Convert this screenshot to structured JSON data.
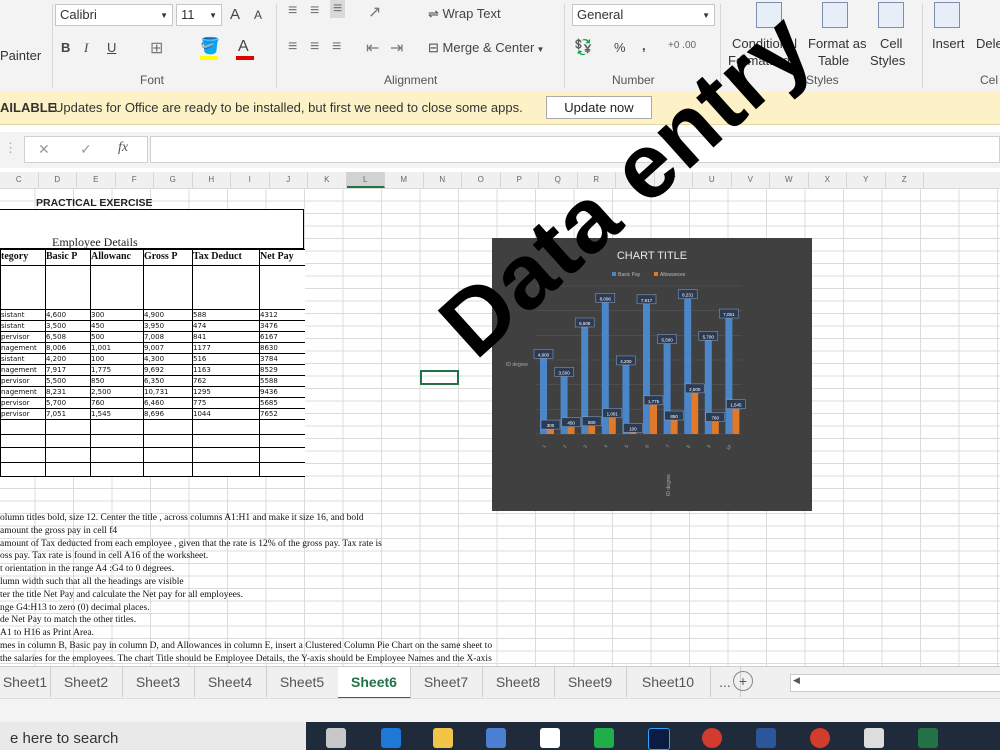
{
  "ribbon": {
    "painter_label": "Painter",
    "font_name": "Calibri",
    "font_size": "11",
    "grow_font": "A",
    "shrink_font": "A",
    "bold": "B",
    "italic": "I",
    "underline": "U",
    "wrap_text": "Wrap Text",
    "merge_center": "Merge & Center",
    "number_format": "General",
    "percent": "%",
    "comma": ",",
    "increase_decimal": "+0 .00",
    "decrease_decimal": ".00 +0",
    "conditional_formatting": [
      "Conditional",
      "Formatting"
    ],
    "format_as_table": [
      "Format as",
      "Table"
    ],
    "cell_styles": [
      "Cell",
      "Styles"
    ],
    "insert": "Insert",
    "delete": "Dele",
    "groups": {
      "font": "Font",
      "alignment": "Alignment",
      "number": "Number",
      "styles": "Styles",
      "cells": "Cel"
    }
  },
  "update_bar": {
    "prefix": "AILABLE",
    "message": "Updates for Office are ready to be installed, but first we need to close some apps.",
    "button": "Update now"
  },
  "formula_bar": {
    "cancel": "✕",
    "enter": "✓",
    "fx": "fx",
    "content": ""
  },
  "columns": [
    "C",
    "D",
    "E",
    "F",
    "G",
    "H",
    "I",
    "J",
    "K",
    "L",
    "M",
    "N",
    "O",
    "P",
    "Q",
    "R",
    "S",
    "T",
    "U",
    "V",
    "W",
    "X",
    "Y",
    "Z"
  ],
  "sheet": {
    "title": "PRACTICAL EXERCISE",
    "subtitle": "Employee Details",
    "headers": [
      "tegory",
      "Basic P",
      "Allowanc",
      "Gross P",
      "Tax Deduct",
      "Net Pay"
    ],
    "rows": [
      [
        "sistant",
        "4,600",
        "300",
        "4,900",
        "588",
        "4312"
      ],
      [
        "sistant",
        "3,500",
        "450",
        "3,950",
        "474",
        "3476"
      ],
      [
        "pervisor",
        "6,508",
        "500",
        "7,008",
        "841",
        "6167"
      ],
      [
        "nagement",
        "8,006",
        "1,001",
        "9,007",
        "1177",
        "8630"
      ],
      [
        "sistant",
        "4,200",
        "100",
        "4,300",
        "516",
        "3784"
      ],
      [
        "nagement",
        "7,917",
        "1,775",
        "9,692",
        "1163",
        "8529"
      ],
      [
        "pervisor",
        "5,500",
        "850",
        "6,350",
        "762",
        "5588"
      ],
      [
        "nagement",
        "8,231",
        "2,500",
        "10,731",
        "1295",
        "9436"
      ],
      [
        "pervisor",
        "5,700",
        "760",
        "6,460",
        "775",
        "5685"
      ],
      [
        "pervisor",
        "7,051",
        "1,545",
        "8,696",
        "1044",
        "7652"
      ]
    ]
  },
  "instructions": [
    "olumn titles bold, size 12. Center the title , across columns  A1:H1  and make it size 16, and bold",
    "amount the gross pay in cell f4",
    "amount of Tax deducted from each employee , given that the rate is 12% of the gross pay. Tax rate is",
    "oss pay. Tax rate is found in cell A16 of  the worksheet.",
    "t orientation  in the range A4 :G4 to 0 degrees.",
    "lumn width such that all the headings are visible",
    "ter the title Net Pay and calculate the Net pay for all employees.",
    "nge G4:H13 to zero (0) decimal places.",
    "de Net Pay to match the other titles.",
    "A1 to H16 as Print Area.",
    "mes in column B, Basic pay in column D, and Allowances in column E, insert a  Clustered Column Pie Chart on the same sheet to",
    "the salaries for the employees. The chart Title should be Employee Details, the Y-axis should be Employee Names  and the X-axis"
  ],
  "chart_data": {
    "type": "bar",
    "title": "CHART TITLE",
    "legend": [
      "Basic Pay",
      "Allowances"
    ],
    "legend_position": "top",
    "xlabel": "ID degree",
    "ylabel": "ID degree",
    "categories": [
      "1",
      "2",
      "3",
      "4",
      "5",
      "6",
      "7",
      "8",
      "9",
      "10"
    ],
    "series": [
      {
        "name": "Basic Pay",
        "color": "#4a86c8",
        "values": [
          4600,
          3500,
          6508,
          8006,
          4200,
          7917,
          5500,
          8231,
          5700,
          7051
        ]
      },
      {
        "name": "Allowances",
        "color": "#e07a2a",
        "values": [
          300,
          450,
          500,
          1001,
          100,
          1775,
          850,
          2500,
          760,
          1545
        ]
      }
    ],
    "data_labels": [
      "4,600",
      "3,500",
      "6,508",
      "8,006",
      "4,200",
      "7,917",
      "5,500",
      "8,231",
      "5,700",
      "7,051",
      "300",
      "450",
      "500",
      "1,001",
      "100",
      "1,775",
      "850",
      "2,500",
      "760",
      "1,545"
    ],
    "ylim": [
      0,
      9000
    ]
  },
  "tabs": [
    "Sheet1",
    "Sheet2",
    "Sheet3",
    "Sheet4",
    "Sheet5",
    "Sheet6",
    "Sheet7",
    "Sheet8",
    "Sheet9",
    "Sheet10",
    "..."
  ],
  "active_tab": "Sheet6",
  "taskbar": {
    "search": "e here to search"
  },
  "watermark": "Data entry",
  "colors": {
    "accent_green": "#217346",
    "chart_bg": "#404040",
    "update_bar": "#fcf1c7"
  }
}
